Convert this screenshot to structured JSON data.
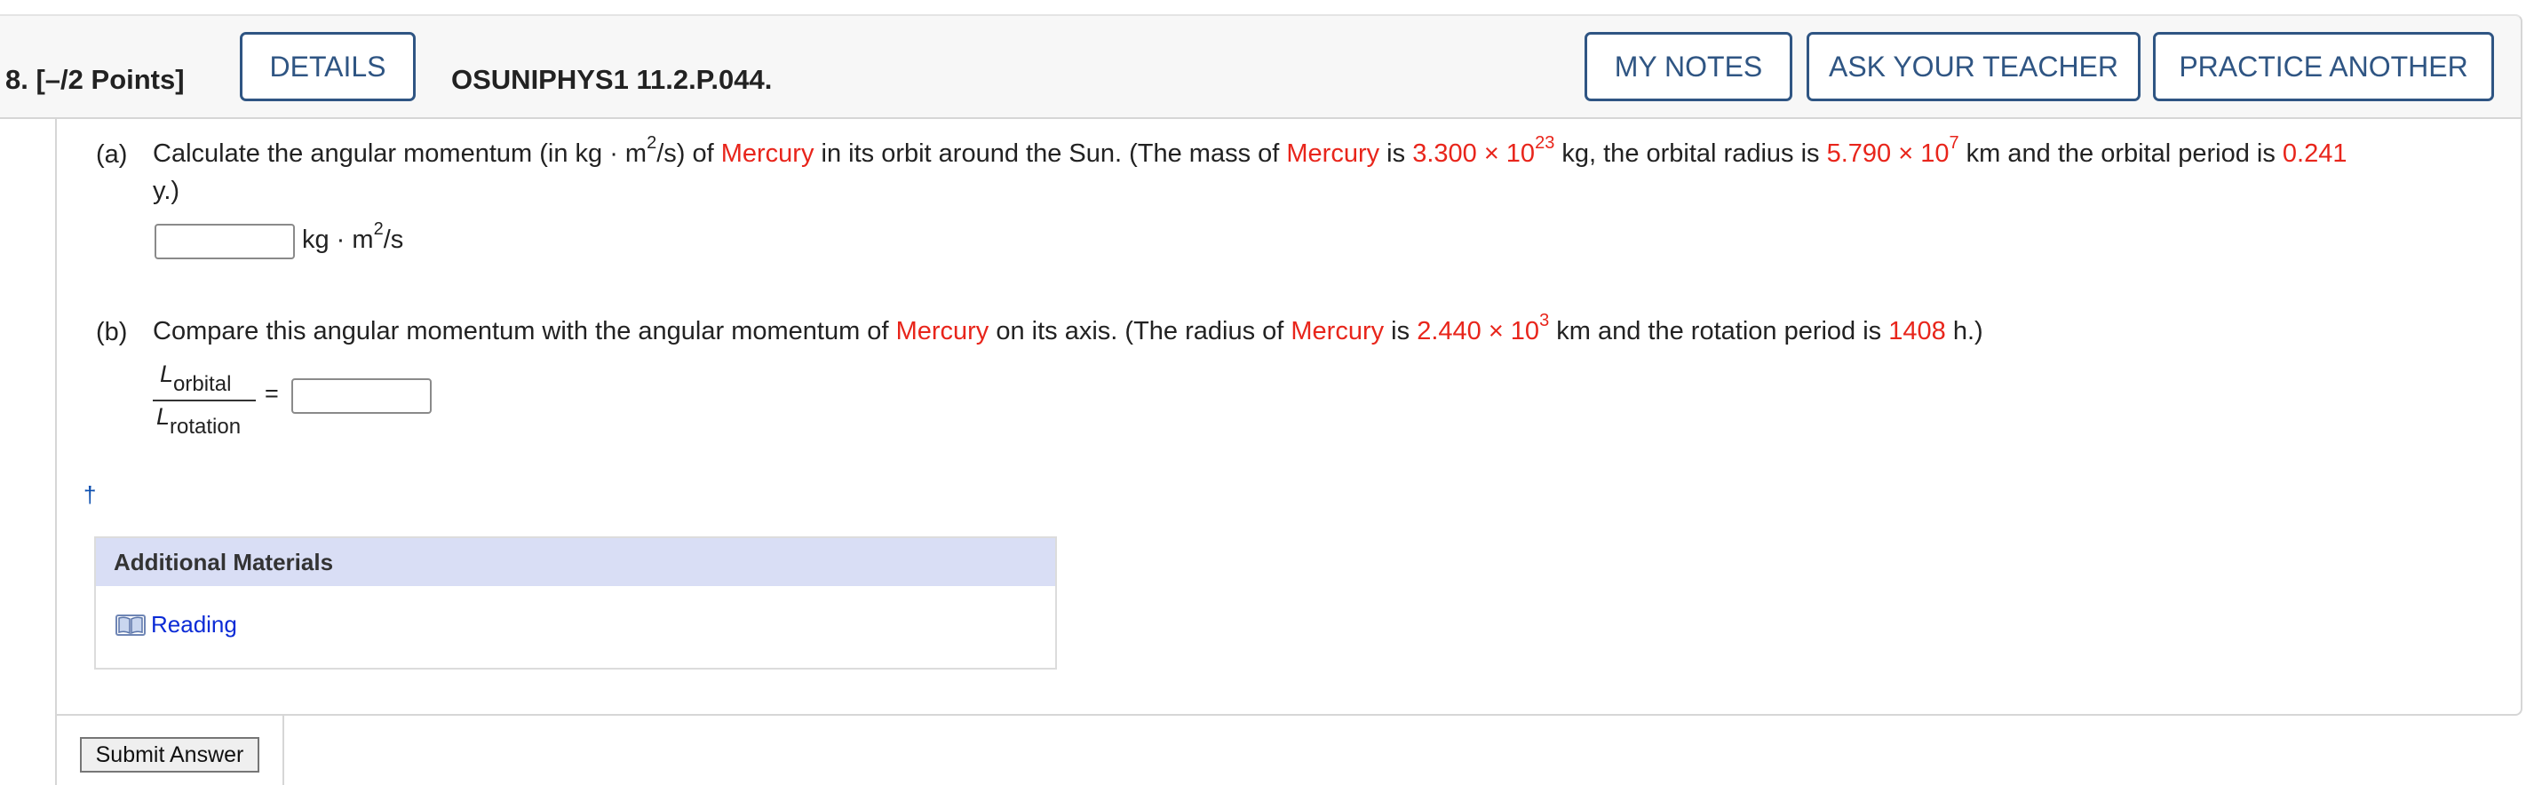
{
  "header": {
    "question_number": "8.",
    "points": "[–/2 Points]",
    "details_label": "DETAILS",
    "problem_code": "OSUNIPHYS1 11.2.P.044.",
    "my_notes_label": "MY NOTES",
    "ask_teacher_label": "ASK YOUR TEACHER",
    "practice_another_label": "PRACTICE ANOTHER"
  },
  "part_a": {
    "label": "(a)",
    "t1": "Calculate the angular momentum (in kg · m",
    "t1_exp": "2",
    "t2": "/s) of ",
    "planet1": "Mercury",
    "t3": " in its orbit around the Sun. (The mass of ",
    "planet2": "Mercury",
    "t4": " is ",
    "mass_mantissa": "3.300 × 10",
    "mass_exp": "23",
    "t5": " kg, the orbital radius is ",
    "radius_mantissa": "5.790 × 10",
    "radius_exp": "7",
    "t6": " km and the orbital period is ",
    "period": "0.241",
    "t7": "y.)",
    "answer_value": "",
    "unit_base": "kg · m",
    "unit_exp": "2",
    "unit_tail": "/s"
  },
  "part_b": {
    "label": "(b)",
    "t1": "Compare this angular momentum with the angular momentum of ",
    "planet1": "Mercury",
    "t2": " on its axis. (The radius of ",
    "planet2": "Mercury",
    "t3": " is ",
    "radius_mantissa": "2.440 × 10",
    "radius_exp": "3",
    "t4": " km and the rotation period is ",
    "rotation_period": "1408",
    "t5": " h.)",
    "numerator_symbol": "L",
    "numerator_sub": "orbital",
    "denominator_symbol": "L",
    "denominator_sub": "rotation",
    "equals": "=",
    "answer_value": ""
  },
  "dagger": "†",
  "additional_materials": {
    "title": "Additional Materials",
    "reading_label": "Reading",
    "reading_icon": "book-icon"
  },
  "submit_label": "Submit Answer",
  "colors": {
    "accent": "#2f5583",
    "value_red": "#e8251b",
    "link_blue": "#0b2bd6",
    "panel_header": "#d9def5"
  }
}
